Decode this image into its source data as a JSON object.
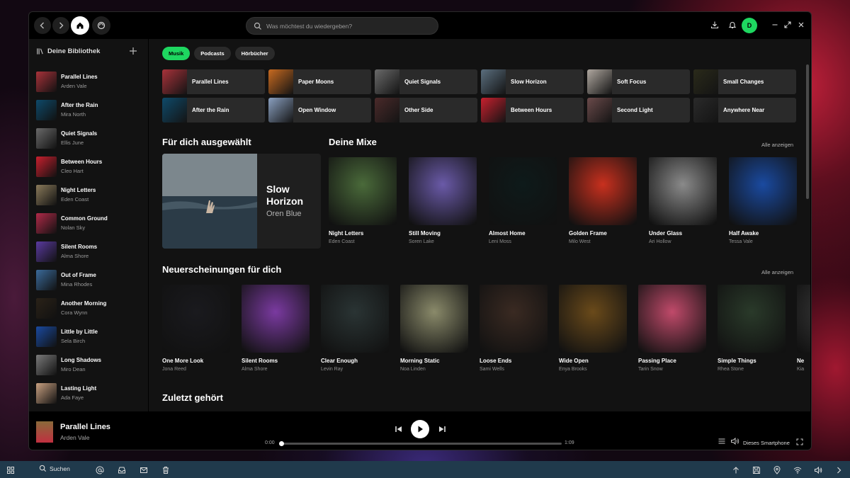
{
  "search": {
    "placeholder": "Was möchtest du wiedergeben?"
  },
  "user": {
    "initial": "D"
  },
  "library": {
    "title": "Deine Bibliothek",
    "items": [
      {
        "title": "Parallel Lines",
        "artist": "Arden Vale",
        "color": "#a8323a"
      },
      {
        "title": "After the Rain",
        "artist": "Mira North",
        "color": "#0e4a6a"
      },
      {
        "title": "Quiet Signals",
        "artist": "Ellis June",
        "color": "#6a6a6a"
      },
      {
        "title": "Between Hours",
        "artist": "Cleo Hart",
        "color": "#c8202e"
      },
      {
        "title": "Night Letters",
        "artist": "Eden Coast",
        "color": "#8a7a5a"
      },
      {
        "title": "Common Ground",
        "artist": "Nolan Sky",
        "color": "#b02a48"
      },
      {
        "title": "Silent Rooms",
        "artist": "Alma Shore",
        "color": "#5a3aa0"
      },
      {
        "title": "Out of Frame",
        "artist": "Mina Rhodes",
        "color": "#3a6a9a"
      },
      {
        "title": "Another Morning",
        "artist": "Cora Wynn",
        "color": "#2a2218"
      },
      {
        "title": "Little by Little",
        "artist": "Sela Birch",
        "color": "#1a4aa0"
      },
      {
        "title": "Long Shadows",
        "artist": "Miro Dean",
        "color": "#7a7a7a"
      },
      {
        "title": "Lasting Light",
        "artist": "Ada Faye",
        "color": "#c8a080"
      }
    ]
  },
  "chips": [
    "Musik",
    "Podcasts",
    "Hörbücher"
  ],
  "quick": [
    {
      "label": "Parallel Lines",
      "color": "#a8323a"
    },
    {
      "label": "Paper Moons",
      "color": "#c86a20"
    },
    {
      "label": "Quiet Signals",
      "color": "#6a6a6a"
    },
    {
      "label": "Slow Horizon",
      "color": "#5a6e7e"
    },
    {
      "label": "Soft Focus",
      "color": "#b0a8a0"
    },
    {
      "label": "Small Changes",
      "color": "#2a2a1a"
    },
    {
      "label": "After the Rain",
      "color": "#0e4a6a"
    },
    {
      "label": "Open Window",
      "color": "#8aa0c0"
    },
    {
      "label": "Other Side",
      "color": "#4a2a2a"
    },
    {
      "label": "Between Hours",
      "color": "#c8202e"
    },
    {
      "label": "Second Light",
      "color": "#6a4a4a"
    },
    {
      "label": "Anywhere Near",
      "color": "#2a2a2a"
    }
  ],
  "picked": {
    "title": "Für dich ausgewählt",
    "feature_title": "Slow Horizon",
    "feature_artist": "Oren Blue"
  },
  "mixes": {
    "title": "Deine Mixe",
    "show_all": "Alle anzeigen",
    "cards": [
      {
        "title": "Night Letters",
        "subtitle": "Eden Coast",
        "color": "#4a6a3a"
      },
      {
        "title": "Still Moving",
        "subtitle": "Soren Lake",
        "color": "#6a5aa8"
      },
      {
        "title": "Almost Home",
        "subtitle": "Leni Moss",
        "color": "#0e1a1a"
      },
      {
        "title": "Golden Frame",
        "subtitle": "Milo West",
        "color": "#c8301e"
      },
      {
        "title": "Under Glass",
        "subtitle": "Ari Hollow",
        "color": "#8a8a8a"
      },
      {
        "title": "Half Awake",
        "subtitle": "Tessa Vale",
        "color": "#1a4aa0"
      }
    ]
  },
  "releases": {
    "title": "Neuerscheinungen für dich",
    "show_all": "Alle anzeigen",
    "cards": [
      {
        "title": "One More Look",
        "subtitle": "Jona Reed",
        "color": "#1a1a1e"
      },
      {
        "title": "Silent Rooms",
        "subtitle": "Alma Shore",
        "color": "#7a3aa0"
      },
      {
        "title": "Clear Enough",
        "subtitle": "Levin Ray",
        "color": "#2a3434"
      },
      {
        "title": "Morning Static",
        "subtitle": "Noa Linden",
        "color": "#8a8a6a"
      },
      {
        "title": "Loose Ends",
        "subtitle": "Sami Wells",
        "color": "#3a2a22"
      },
      {
        "title": "Wide Open",
        "subtitle": "Enya Brooks",
        "color": "#6a4a1a"
      },
      {
        "title": "Passing Place",
        "subtitle": "Tarin Snow",
        "color": "#c04a6a"
      },
      {
        "title": "Simple Things",
        "subtitle": "Rhea Stone",
        "color": "#2a3a2a"
      },
      {
        "title": "Ne",
        "subtitle": "Kia",
        "color": "#3a3a3a"
      }
    ]
  },
  "recent": {
    "title": "Zuletzt gehört"
  },
  "player": {
    "title": "Parallel Lines",
    "artist": "Arden Vale",
    "elapsed": "0:00",
    "duration": "1:09",
    "progress": 0,
    "device": "Dieses Smartphone"
  },
  "taskbar": {
    "search_label": "Suchen"
  },
  "colors": {
    "accent": "#1ed760",
    "taskbar": "#203a4c"
  }
}
